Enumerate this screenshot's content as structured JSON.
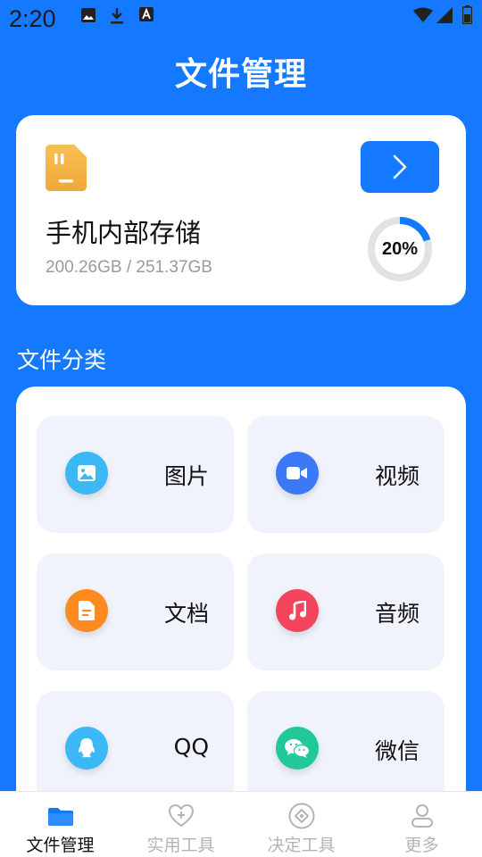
{
  "status_bar": {
    "time": "2:20"
  },
  "header": {
    "title": "文件管理"
  },
  "storage": {
    "name": "手机内部存储",
    "size_text": "200.26GB / 251.37GB",
    "used_percent": 20,
    "usage_label": "20%"
  },
  "section": {
    "title": "文件分类"
  },
  "categories": [
    {
      "label": "图片",
      "icon": "image-icon",
      "color": "#3bb8f5"
    },
    {
      "label": "视频",
      "icon": "video-icon",
      "color": "#3d78f7"
    },
    {
      "label": "文档",
      "icon": "document-icon",
      "color": "#ff8a1f"
    },
    {
      "label": "音频",
      "icon": "music-icon",
      "color": "#f5455c"
    },
    {
      "label": "QQ",
      "icon": "qq-icon",
      "color": "#3bb8f5"
    },
    {
      "label": "微信",
      "icon": "wechat-icon",
      "color": "#20c997"
    }
  ],
  "nav": [
    {
      "label": "文件管理",
      "icon": "folder-icon",
      "active": true
    },
    {
      "label": "实用工具",
      "icon": "heart-plus-icon",
      "active": false
    },
    {
      "label": "决定工具",
      "icon": "compass-icon",
      "active": false
    },
    {
      "label": "更多",
      "icon": "person-icon",
      "active": false
    }
  ],
  "colors": {
    "primary": "#1479ff",
    "tile_bg": "#f1f3fc",
    "ring_track": "#e2e2e2"
  }
}
